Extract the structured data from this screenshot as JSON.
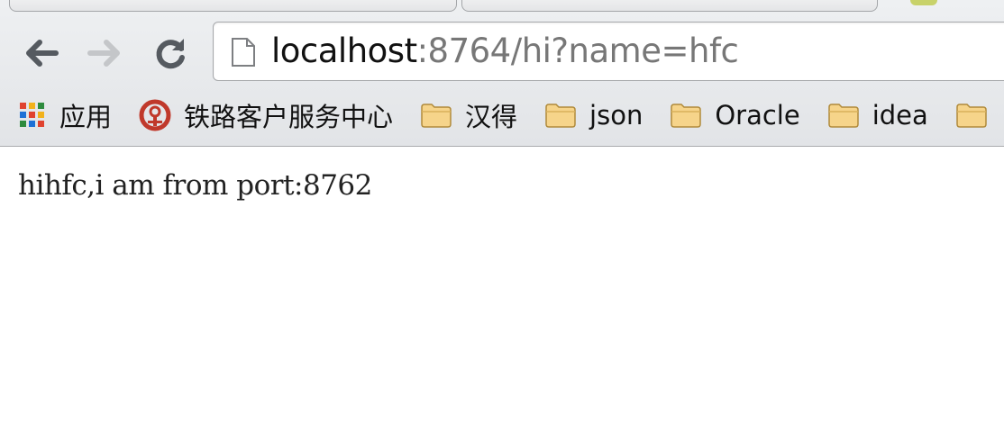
{
  "browser": {
    "url_host": "localhost",
    "url_rest": ":8764/hi?name=hfc"
  },
  "bookmarks": [
    {
      "label": "应用",
      "icon": "apps-grid-icon"
    },
    {
      "label": "铁路客户服务中心",
      "icon": "railway-logo-icon"
    },
    {
      "label": "汉得",
      "icon": "folder-icon"
    },
    {
      "label": "json",
      "icon": "folder-icon"
    },
    {
      "label": "Oracle",
      "icon": "folder-icon"
    },
    {
      "label": "idea",
      "icon": "folder-icon"
    }
  ],
  "page": {
    "text": "hihfc,i am from port:8762"
  },
  "colors": {
    "chrome_bg": "#e4e6e9",
    "url_host": "#111111",
    "url_rest": "#777777",
    "folder_fill": "#f6d48a",
    "railway_logo": "#c0392b"
  }
}
